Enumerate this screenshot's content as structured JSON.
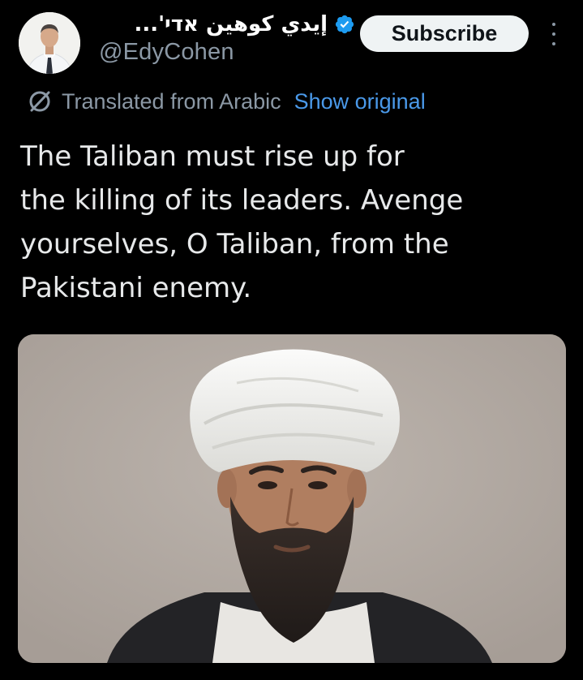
{
  "author": {
    "display_name": "إيدي كوهين אדי'...",
    "handle": "@EdyCohen",
    "verified": true
  },
  "actions": {
    "subscribe_label": "Subscribe"
  },
  "translation": {
    "label": "Translated from Arabic",
    "show_original_label": "Show original"
  },
  "tweet": {
    "lines": [
      "The Taliban must rise up for",
      "the killing of its leaders. Avenge",
      "yourselves, O Taliban, from the",
      "Pakistani enemy."
    ]
  },
  "colors": {
    "background": "#000000",
    "text": "#e7e9ea",
    "secondary_text": "#8b98a5",
    "link": "#4a99e9",
    "verified_badge": "#1d9bf0",
    "button_bg": "#eff3f4"
  },
  "icons": {
    "verified": "verified-badge-icon",
    "translate": "translate-icon",
    "more": "more-vertical-icon"
  }
}
